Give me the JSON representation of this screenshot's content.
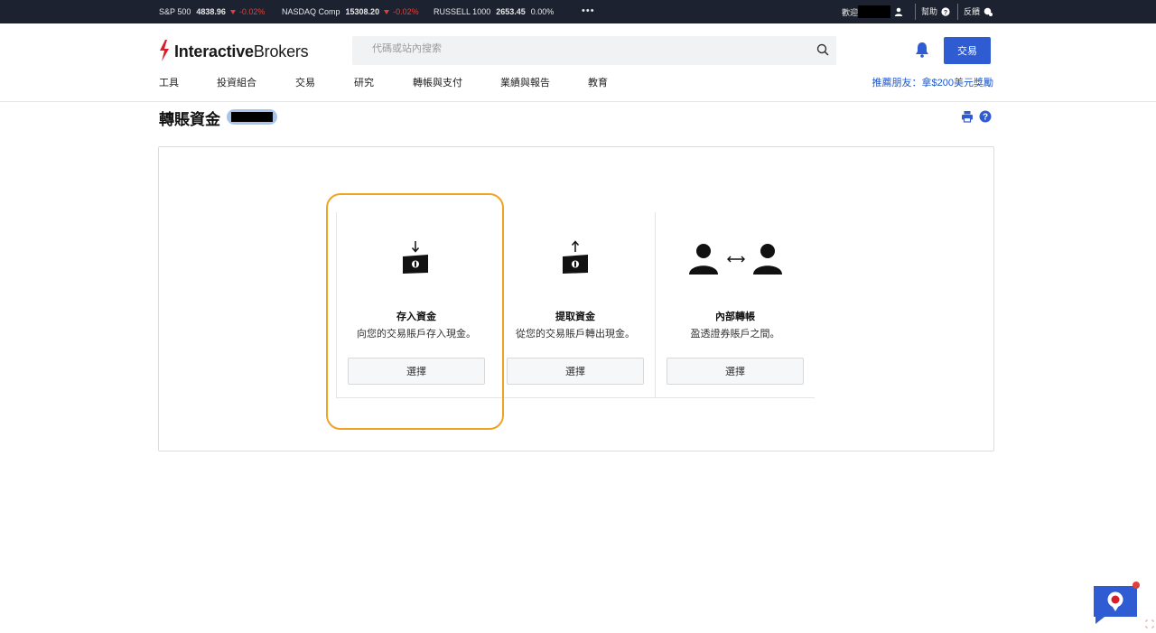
{
  "ticker": {
    "items": [
      {
        "name": "S&P 500",
        "value": "4838.96",
        "change": "-0.02%"
      },
      {
        "name": "NASDAQ Comp",
        "value": "15308.20",
        "change": "-0.02%"
      },
      {
        "name": "RUSSELL 1000",
        "value": "2653.45",
        "change": "0.00%"
      }
    ],
    "more": "•••",
    "welcome_label": "歡迎 ",
    "help_label": "幫助",
    "feedback_label": "反饋"
  },
  "header": {
    "logo_bold": "Interactive",
    "logo_regular": "Brokers",
    "search_placeholder": "代碼或站內搜索",
    "trade_button": "交易",
    "nav": [
      "工具",
      "投資組合",
      "交易",
      "研究",
      "轉帳與支付",
      "業績與報告",
      "教育"
    ],
    "promo": "推薦朋友：拿$200美元獎勵"
  },
  "page": {
    "title": "轉賬資金"
  },
  "cards": [
    {
      "title": "存入資金",
      "desc": "向您的交易賬戶存入現金。",
      "button": "選擇",
      "icon": "deposit-icon"
    },
    {
      "title": "提取資金",
      "desc": "從您的交易賬戶轉出現金。",
      "button": "選擇",
      "icon": "withdraw-icon"
    },
    {
      "title": "內部轉帳",
      "desc": "盈透證券賬戶之間。",
      "button": "選擇",
      "icon": "internal-transfer-icon"
    }
  ],
  "colors": {
    "accent": "#2f5bd3",
    "highlight": "#f0a320",
    "ticker_bg": "#1c2230",
    "negative": "#e0403a"
  }
}
